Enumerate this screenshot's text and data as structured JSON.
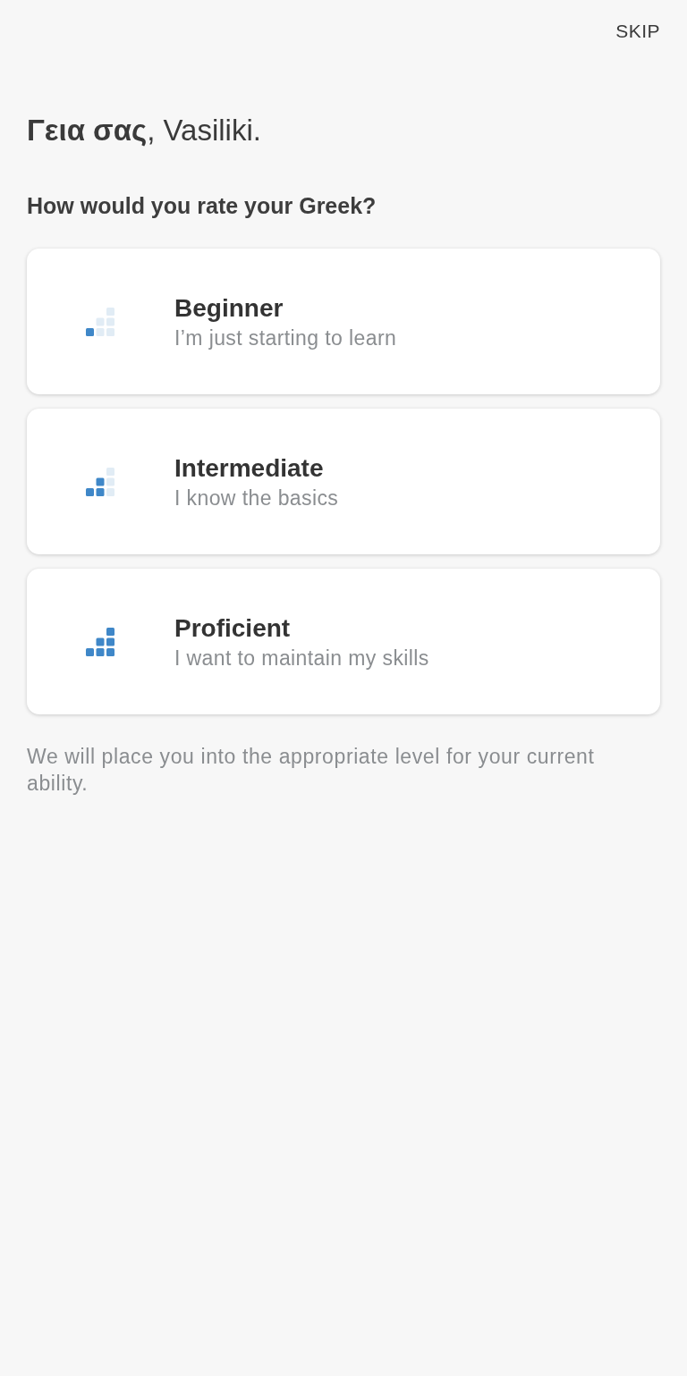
{
  "header": {
    "skip_label": "SKIP"
  },
  "greeting": "**Γεια σας**, Vasiliki.",
  "question": "How would you rate your Greek?",
  "levels": [
    {
      "kind": "beginner",
      "title": "Beginner",
      "subtitle": "I’m just starting to learn"
    },
    {
      "kind": "intermediate",
      "title": "Intermediate",
      "subtitle": "I know the basics"
    },
    {
      "kind": "proficient",
      "title": "Proficient",
      "subtitle": "I want to maintain my skills"
    }
  ],
  "footnote": "We will place you into the appropriate level for your current ability."
}
